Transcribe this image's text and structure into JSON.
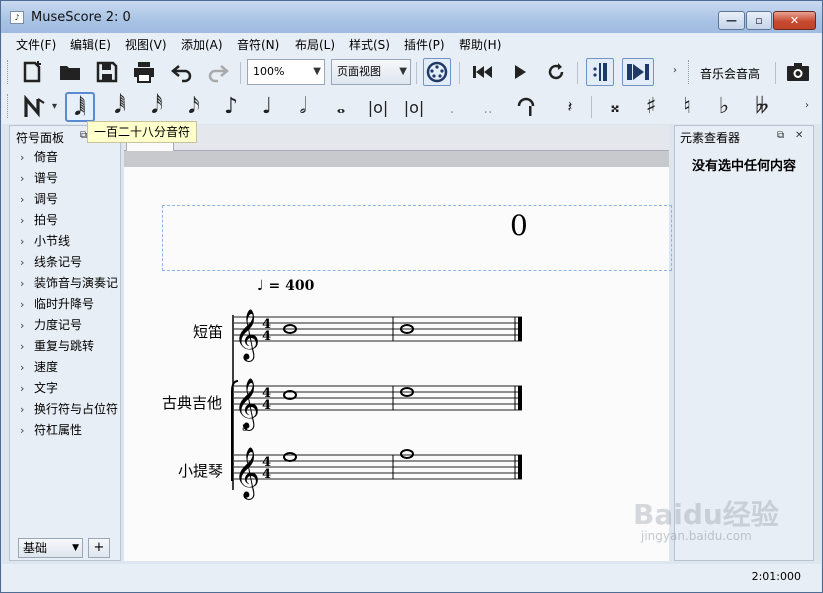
{
  "window": {
    "title": "MuseScore 2: 0",
    "min_glyph": "—",
    "max_glyph": "▫",
    "close_glyph": "✕"
  },
  "menu": [
    "文件(F)",
    "编辑(E)",
    "视图(V)",
    "添加(A)",
    "音符(N)",
    "布局(L)",
    "样式(S)",
    "插件(P)",
    "帮助(H)"
  ],
  "toolbar": {
    "zoom_value": "100%",
    "view_mode": "页面视图",
    "concert_pitch": "音乐会音高",
    "icons": [
      "new-score-icon",
      "open-icon",
      "save-icon",
      "print-icon",
      "undo-icon",
      "redo-icon",
      "midi-input-icon",
      "rewind-icon",
      "play-icon",
      "loop-icon",
      "repeat-icon",
      "pan-icon",
      "camera-icon"
    ]
  },
  "note_input": {
    "tooltip": "一百二十八分音符",
    "selected_index": 1
  },
  "palette": {
    "title": "符号面板",
    "items": [
      "倚音",
      "谱号",
      "调号",
      "拍号",
      "小节线",
      "线条记号",
      "装饰音与演奏记",
      "临时升降号",
      "力度记号",
      "重复与跳转",
      "速度",
      "文字",
      "换行符与占位符",
      "符杠属性"
    ],
    "workspace": "基础",
    "add_label": "+"
  },
  "score": {
    "title": "0",
    "tempo": "♩ = 400",
    "instruments": [
      "短笛",
      "古典吉他",
      "小提琴"
    ],
    "time_signature": "4/4"
  },
  "inspector": {
    "title": "元素查看器",
    "empty_text": "没有选中任何内容"
  },
  "status": {
    "time": "2:01:000"
  },
  "watermark": {
    "logo": "Baidu经验",
    "url": "jingyan.baidu.com"
  }
}
